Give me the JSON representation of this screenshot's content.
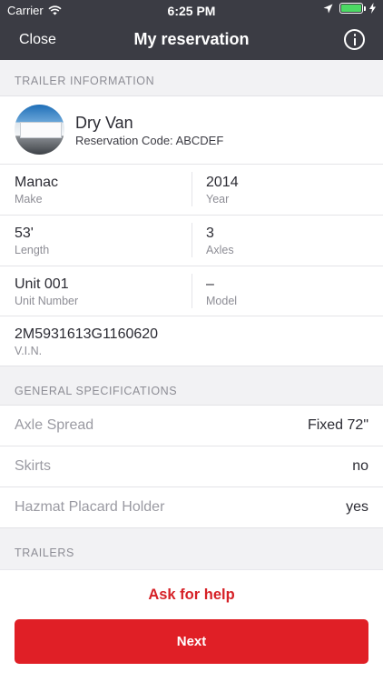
{
  "status_bar": {
    "carrier": "Carrier",
    "time": "6:25 PM"
  },
  "nav": {
    "close_label": "Close",
    "title": "My reservation",
    "info_icon": "info-icon"
  },
  "trailer_info": {
    "section_title": "TRAILER INFORMATION",
    "name": "Dry Van",
    "reservation_code": "Reservation Code: ABCDEF",
    "fields": {
      "make": {
        "value": "Manac",
        "label": "Make"
      },
      "year": {
        "value": "2014",
        "label": "Year"
      },
      "length": {
        "value": "53'",
        "label": "Length"
      },
      "axles": {
        "value": "3",
        "label": "Axles"
      },
      "unit_number": {
        "value": "Unit 001",
        "label": "Unit Number"
      },
      "model": {
        "value": "–",
        "label": "Model"
      },
      "vin": {
        "value": "2M5931613G1160620",
        "label": "V.I.N."
      }
    }
  },
  "general_specs": {
    "section_title": "GENERAL SPECIFICATIONS",
    "items": [
      {
        "label": "Axle Spread",
        "value": "Fixed 72\""
      },
      {
        "label": "Skirts",
        "value": "no"
      },
      {
        "label": "Hazmat Placard Holder",
        "value": "yes"
      }
    ]
  },
  "trailers_section": {
    "section_title": "TRAILERS"
  },
  "footer": {
    "help_label": "Ask for help",
    "next_label": "Next"
  },
  "colors": {
    "nav_bg": "#3b3c44",
    "accent_red": "#e01f26",
    "battery_green": "#4cd964"
  }
}
